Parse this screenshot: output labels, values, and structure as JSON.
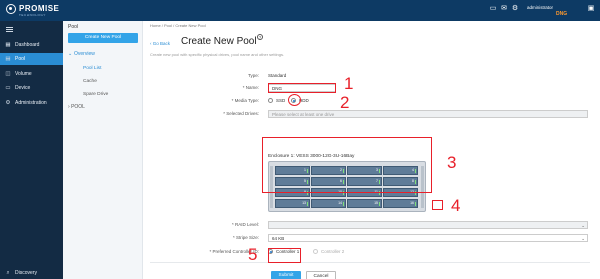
{
  "topbar": {
    "logo_name": "PROMISE",
    "logo_sub": "TECHNOLOGY",
    "user": "administrator",
    "user_sub": "DNG",
    "icons": [
      "monitor-icon",
      "envelope-icon",
      "settings-icon",
      "user-icon"
    ]
  },
  "leftnav": {
    "items": [
      {
        "label": "Dashboard",
        "icon": "dashboard-icon"
      },
      {
        "label": "Pool",
        "icon": "pool-icon"
      },
      {
        "label": "Volume",
        "icon": "volume-icon"
      },
      {
        "label": "Device",
        "icon": "device-icon"
      },
      {
        "label": "Administration",
        "icon": "admin-icon"
      },
      {
        "label": "Discovery",
        "icon": "discovery-icon"
      }
    ]
  },
  "subnav": {
    "title": "Pool",
    "create_button": "Create New Pool",
    "group": "Overview",
    "items": [
      "Pool List",
      "Cache",
      "Spare Drive"
    ],
    "pool_section": "POOL"
  },
  "main": {
    "breadcrumb": "Home / Pool / Create New Pool",
    "back": "Go Back",
    "title": "Create New Pool",
    "description": "Create new pool with specific physical drives, pool name and other settings.",
    "form": {
      "type_label": "Type:",
      "type_value": "Standard",
      "name_label": "* Name:",
      "name_value": "DNG",
      "media_label": "* Media Type:",
      "media_ssd": "SSD",
      "media_hdd": "HDD",
      "drives_label": "* Selected Drives:",
      "drives_placeholder": "Please select at least one drive",
      "enclosure_title": "Enclosure 1: VESS 3000-12G-3U-16Bay",
      "raid_label": "* RAID Level:",
      "stripe_label": "* Stripe Size:",
      "stripe_value": "64 KB",
      "controller_label": "* Preferred Controller ID:",
      "controller_1": "Controller 1",
      "controller_2": "Controller 2"
    },
    "buttons": {
      "submit": "Submit",
      "cancel": "Cancel"
    }
  },
  "drives": [
    "1",
    "2",
    "3",
    "4",
    "5",
    "6",
    "7",
    "8",
    "9",
    "10",
    "11",
    "12",
    "13",
    "14",
    "15",
    "16"
  ],
  "annotations": [
    "1",
    "2",
    "3",
    "4",
    "5"
  ],
  "colors": {
    "accent": "#33a4e8",
    "nav_bg": "#132b44",
    "topbar": "#0d3a64",
    "annotation": "#e8202a"
  }
}
